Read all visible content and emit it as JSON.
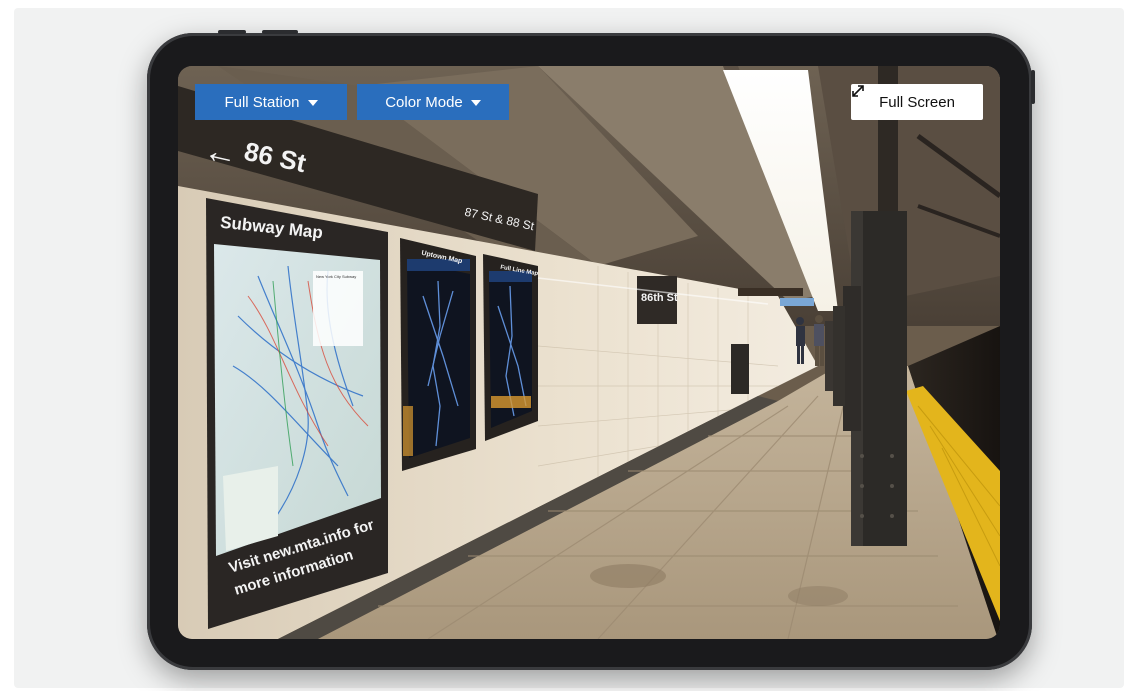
{
  "toolbar": {
    "station_label": "Full Station",
    "color_mode_label": "Color Mode",
    "fullscreen_label": "Full Screen",
    "station_icon": "chevron-down-icon",
    "color_mode_icon": "chevron-down-icon",
    "fullscreen_icon": "expand-arrows-icon"
  },
  "scene": {
    "direction_sign": "86 St",
    "exit_sign": "87 St & 88 St",
    "subway_map_title": "Subway Map",
    "subway_map_footer_line1": "Visit new.mta.info for",
    "subway_map_footer_line2": "more information",
    "uptown_map_label": "Uptown Map",
    "full_line_map_label": "Full Line Map",
    "station_wall_sign": "86th St",
    "map_legend_title": "New York City Subway"
  },
  "colors": {
    "button_blue": "#2a6ebd",
    "platform_edge_yellow": "#e3b51c"
  }
}
